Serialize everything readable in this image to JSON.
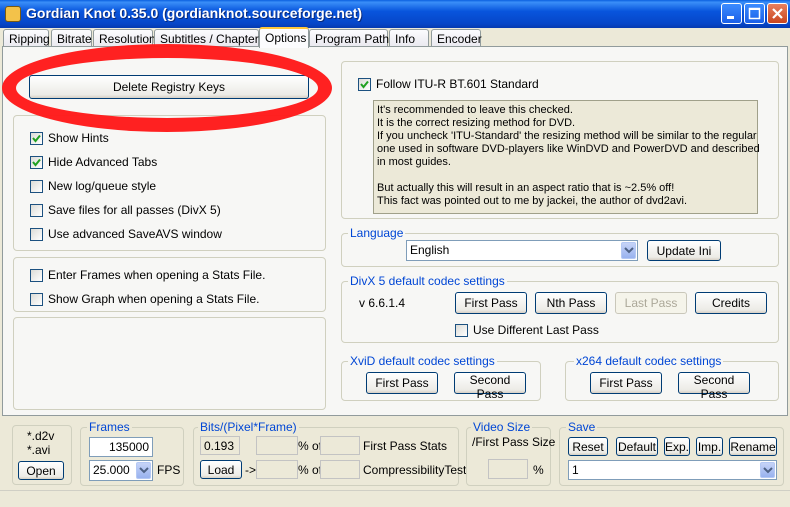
{
  "window": {
    "title": "Gordian Knot 0.35.0  (gordianknot.sourceforge.net)",
    "accent": "#0855dd"
  },
  "tabs": [
    {
      "label": "Ripping"
    },
    {
      "label": "Bitrate"
    },
    {
      "label": "Resolution"
    },
    {
      "label": "Subtitles / Chapters"
    },
    {
      "label": "Options",
      "active": true
    },
    {
      "label": "Program Paths"
    },
    {
      "label": "Info"
    },
    {
      "label": "Encoder"
    }
  ],
  "options": {
    "delete_registry_label": "Delete Registry Keys",
    "checks1": [
      {
        "label": "Show Hints",
        "checked": true
      },
      {
        "label": "Hide Advanced Tabs",
        "checked": true
      },
      {
        "label": "New log/queue style",
        "checked": false
      },
      {
        "label": "Save files for all passes (DivX 5)",
        "checked": false
      },
      {
        "label": "Use advanced SaveAVS window",
        "checked": false
      }
    ],
    "checks2": [
      {
        "label": "Enter Frames when opening a Stats File.",
        "checked": false
      },
      {
        "label": "Show Graph when opening a Stats File.",
        "checked": false
      }
    ],
    "itu": {
      "label": "Follow ITU-R BT.601 Standard",
      "checked": true,
      "info": [
        "It's recommended  to leave this checked.",
        "It is the correct resizing method for DVD.",
        "If you uncheck 'ITU-Standard' the resizing method will be similar to the regular",
        "one used in software DVD-players like WinDVD and PowerDVD and described",
        "in most guides.",
        "",
        "But actually this will result in an aspect ratio that is ~2.5% off!",
        "This fact was pointed out to me by jackei, the author of dvd2avi."
      ]
    },
    "language": {
      "title": "Language",
      "selected": "English",
      "update_label": "Update Ini"
    },
    "divx": {
      "title": "DivX 5 default codec settings",
      "version": "v 6.6.1.4",
      "first_pass": "First Pass",
      "nth_pass": "Nth Pass",
      "last_pass": "Last Pass",
      "credits": "Credits",
      "use_diff_label": "Use Different Last Pass",
      "use_diff_checked": false
    },
    "xvid": {
      "title": "XviD default codec settings",
      "first_pass": "First Pass",
      "second_pass": "Second Pass"
    },
    "x264": {
      "title": "x264 default codec settings",
      "first_pass": "First Pass",
      "second_pass": "Second Pass"
    }
  },
  "bottom": {
    "file_types": [
      "*.d2v",
      "*.avi"
    ],
    "open_label": "Open",
    "frames": {
      "title": "Frames",
      "value": "135000",
      "fps_value": "25.000",
      "fps_label": "FPS"
    },
    "bits": {
      "title": "Bits/(Pixel*Frame)",
      "value": "0.193",
      "load_label": "Load",
      "arrow": "->",
      "pct_of_1": "% of",
      "pct_of_2": "% of",
      "first_pass_stats": "First Pass Stats",
      "compressibility": "CompressibilityTest"
    },
    "video_size": {
      "title": "Video Size",
      "subtitle": "/First Pass Size",
      "percent": "%"
    },
    "save": {
      "title": "Save",
      "reset": "Reset",
      "default": "Default",
      "exp": "Exp.",
      "imp": "Imp.",
      "rename": "Rename",
      "selected": "1"
    }
  },
  "annotation_color": "#ff1a1a"
}
